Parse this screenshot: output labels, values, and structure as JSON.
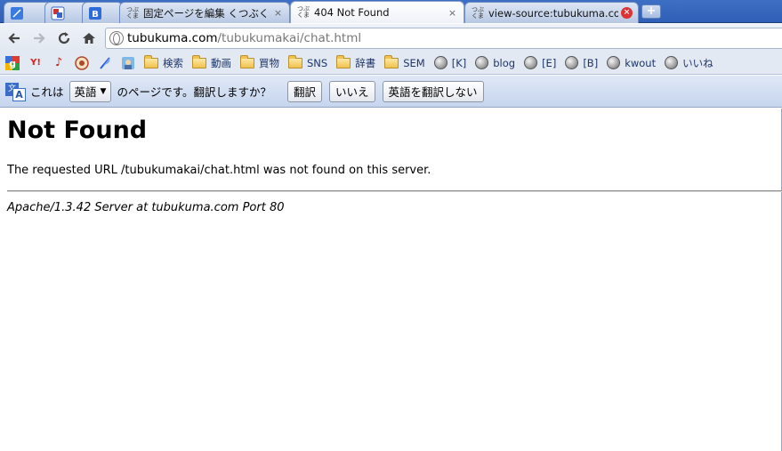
{
  "browser": {
    "tabs": [
      {
        "title": "",
        "favicon": "feather-icon",
        "color": "#3b7be0"
      },
      {
        "title": "",
        "favicon": "gadget-icon",
        "color": "#cc3333"
      },
      {
        "title": "",
        "favicon": "b-icon",
        "color": "#2d6bd6",
        "letter": "B"
      },
      {
        "title": "固定ページを編集 くつぶくま -",
        "favicon_text": "つぶくま"
      },
      {
        "title": "404 Not Found",
        "favicon_text": "つぶくま",
        "active": true
      },
      {
        "title": "view-source:tubukuma.com/",
        "favicon_text": "つぶくま"
      }
    ],
    "new_tab_label": "+",
    "close_glyph": "×",
    "address": {
      "host": "tubukuma.com",
      "path": "/tubukumakai/chat.html"
    },
    "bookmarks": [
      {
        "label": "",
        "icon": "google-icon"
      },
      {
        "label": "",
        "icon": "yahoo-icon",
        "text": "Y!"
      },
      {
        "label": "",
        "icon": "music-icon",
        "text": "♪"
      },
      {
        "label": "",
        "icon": "badge-icon"
      },
      {
        "label": "",
        "icon": "feather-icon"
      },
      {
        "label": "",
        "icon": "photo-icon"
      },
      {
        "label": "検索",
        "icon": "folder-icon"
      },
      {
        "label": "動画",
        "icon": "folder-icon"
      },
      {
        "label": "買物",
        "icon": "folder-icon"
      },
      {
        "label": "SNS",
        "icon": "folder-icon"
      },
      {
        "label": "辞書",
        "icon": "folder-icon"
      },
      {
        "label": "SEM",
        "icon": "folder-icon"
      },
      {
        "label": "[K]",
        "icon": "globe-icon"
      },
      {
        "label": "blog",
        "icon": "globe-icon"
      },
      {
        "label": "[E]",
        "icon": "globe-icon"
      },
      {
        "label": "[B]",
        "icon": "globe-icon"
      },
      {
        "label": "kwout",
        "icon": "globe-icon"
      },
      {
        "label": "いいね",
        "icon": "globe-icon"
      }
    ]
  },
  "translate_bar": {
    "prefix": "これは",
    "language": "英語",
    "suffix": "のページです。翻訳しますか？",
    "translate_label": "翻訳",
    "no_label": "いいえ",
    "never_label": "英語を翻訳しない"
  },
  "page": {
    "heading": "Not Found",
    "message": "The requested URL /tubukumakai/chat.html was not found on this server.",
    "server": "Apache/1.3.42 Server at tubukuma.com Port 80"
  }
}
